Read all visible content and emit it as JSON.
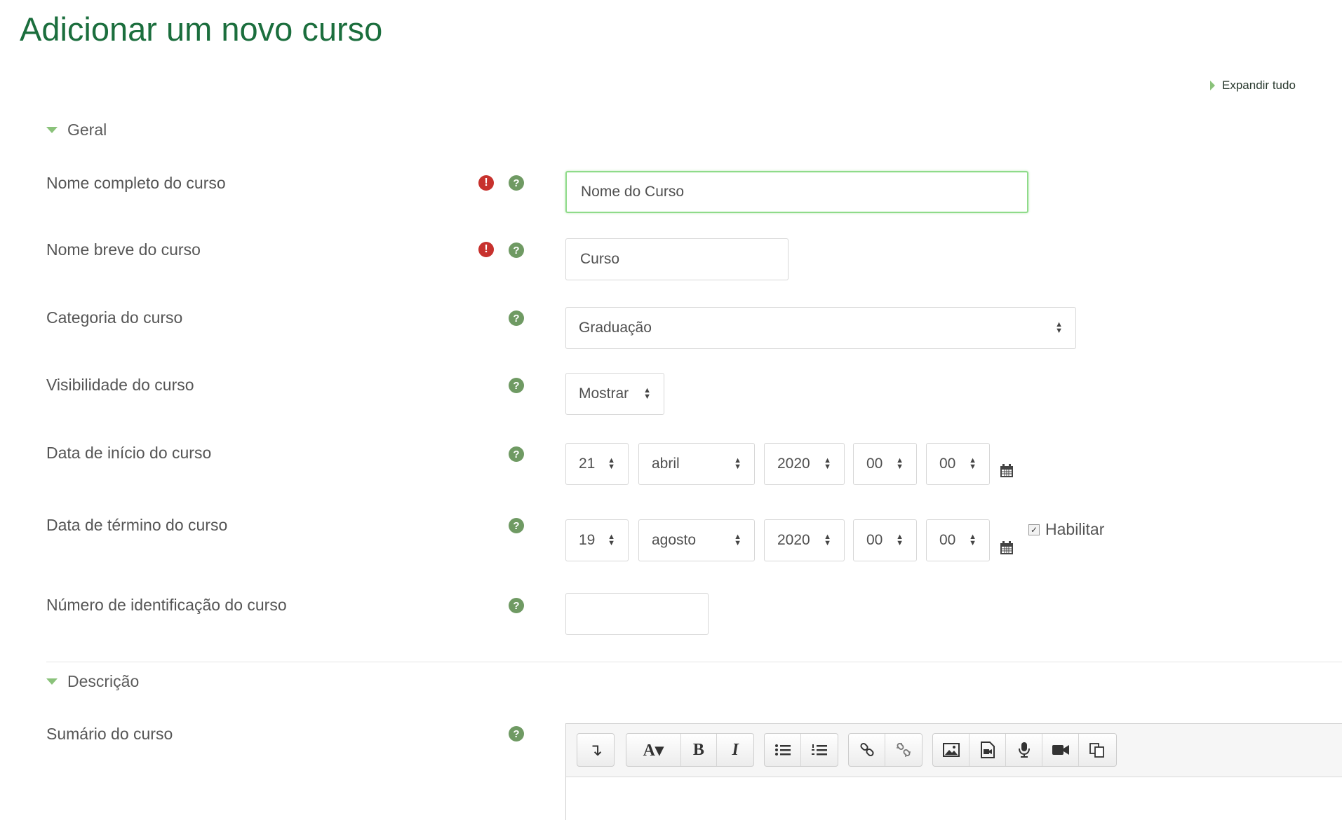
{
  "page": {
    "title": "Adicionar um novo curso",
    "expand_all": "Expandir tudo"
  },
  "sections": {
    "general": "Geral",
    "description": "Descrição"
  },
  "fields": {
    "fullname": {
      "label": "Nome completo do curso",
      "value": "Nome do Curso"
    },
    "shortname": {
      "label": "Nome breve do curso",
      "value": "Curso"
    },
    "category": {
      "label": "Categoria do curso",
      "value": "Graduação"
    },
    "visibility": {
      "label": "Visibilidade do curso",
      "value": "Mostrar"
    },
    "start_date": {
      "label": "Data de início do curso",
      "day": "21",
      "month": "abril",
      "year": "2020",
      "hour": "00",
      "minute": "00"
    },
    "end_date": {
      "label": "Data de término do curso",
      "day": "19",
      "month": "agosto",
      "year": "2020",
      "hour": "00",
      "minute": "00",
      "enable_label": "Habilitar",
      "enabled": true
    },
    "idnumber": {
      "label": "Número de identificação do curso",
      "value": ""
    },
    "summary": {
      "label": "Sumário do curso"
    }
  },
  "icons": {
    "required": "exclamation-circle-icon",
    "help": "question-circle-icon",
    "calendar": "calendar-icon",
    "required_color": "#c7312d",
    "help_color": "#6f9a63",
    "title_color": "#1b6e3d",
    "focus_border_color": "#8fdb8a"
  },
  "editor": {
    "toolbar": {
      "collapse": "↴",
      "style": "A▾",
      "bold": "B",
      "italic": "I"
    }
  }
}
